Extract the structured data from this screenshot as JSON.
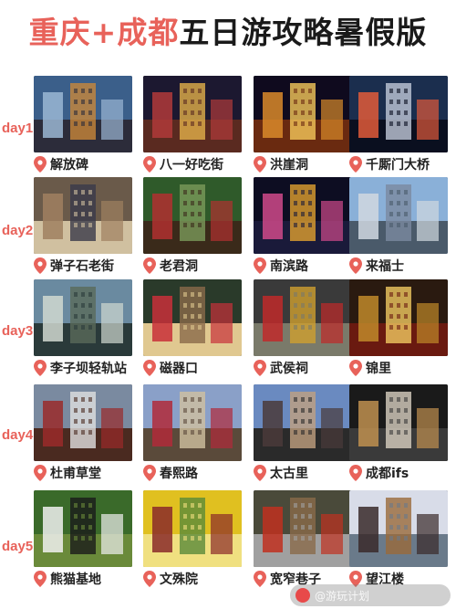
{
  "title": {
    "part1": "重庆+成都",
    "part2": "五日游攻略暑假版"
  },
  "days": [
    {
      "label": "day1",
      "places": [
        "解放碑",
        "八一好吃街",
        "洪崖洞",
        "千厮门大桥"
      ]
    },
    {
      "label": "day2",
      "places": [
        "弹子石老街",
        "老君洞",
        "南滨路",
        "来福士"
      ]
    },
    {
      "label": "day3",
      "places": [
        "李子坝轻轨站",
        "磁器口",
        "武侯祠",
        "锦里"
      ]
    },
    {
      "label": "day4",
      "places": [
        "杜甫草堂",
        "春熙路",
        "太古里",
        "成都ifs"
      ]
    },
    {
      "label": "day5",
      "places": [
        "熊猫基地",
        "文殊院",
        "宽窄巷子",
        "望江楼"
      ]
    }
  ],
  "colors": {
    "accent": "#e8625a",
    "pin": "#e8625a"
  },
  "icons": {
    "pin": "location-pin-icon"
  },
  "watermark": "@游玩计划"
}
